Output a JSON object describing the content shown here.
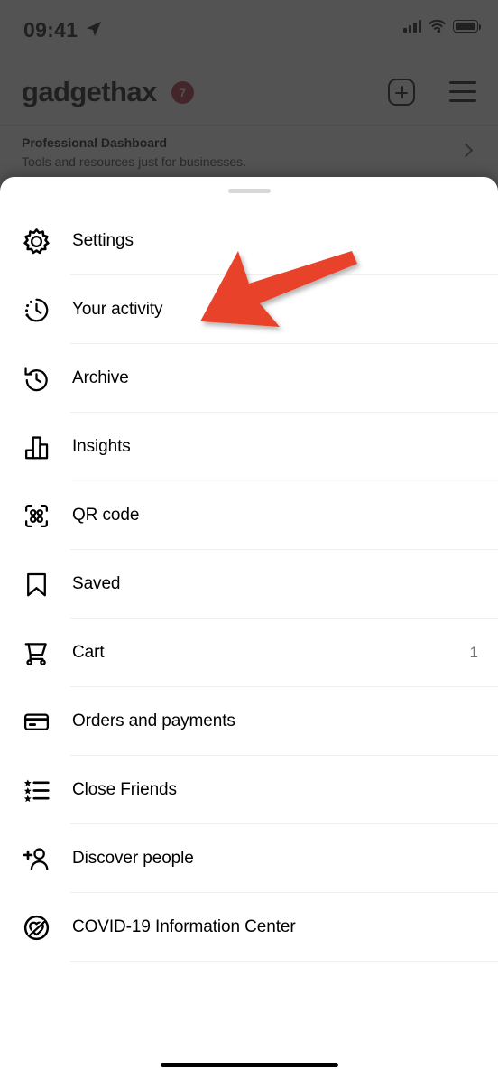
{
  "status_bar": {
    "time": "09:41",
    "location_icon": "location-arrow-icon",
    "cellular_icon": "cellular-signal-icon",
    "cellular_bars": 4,
    "wifi_icon": "wifi-icon",
    "battery_icon": "battery-full-icon"
  },
  "app_header": {
    "brand": "gadgethax",
    "notification_badge": "7",
    "badge_color": "#B02030",
    "add_icon": "plus-square-icon",
    "menu_icon": "hamburger-menu-icon"
  },
  "professional_dashboard": {
    "title": "Professional Dashboard",
    "subtitle": "Tools and resources just for businesses.",
    "chevron_icon": "chevron-right-icon"
  },
  "sheet": {
    "grabber": "drag-handle",
    "items": [
      {
        "label": "Settings",
        "icon": "gear-icon",
        "value": "",
        "divider": true
      },
      {
        "label": "Your activity",
        "icon": "clock-activity-icon",
        "value": "",
        "divider": true
      },
      {
        "label": "Archive",
        "icon": "archive-clock-icon",
        "value": "",
        "divider": true
      },
      {
        "label": "Insights",
        "icon": "bar-chart-icon",
        "value": "",
        "divider": true
      },
      {
        "label": "QR code",
        "icon": "qr-code-icon",
        "value": "",
        "divider": true
      },
      {
        "label": "Saved",
        "icon": "bookmark-icon",
        "value": "",
        "divider": true
      },
      {
        "label": "Cart",
        "icon": "shopping-cart-icon",
        "value": "1",
        "divider": true
      },
      {
        "label": "Orders and payments",
        "icon": "credit-card-icon",
        "value": "",
        "divider": true
      },
      {
        "label": "Close Friends",
        "icon": "star-list-icon",
        "value": "",
        "divider": true
      },
      {
        "label": "Discover people",
        "icon": "add-person-icon",
        "value": "",
        "divider": true
      },
      {
        "label": "COVID-19 Information Center",
        "icon": "heart-circle-icon",
        "value": "",
        "divider": true
      }
    ]
  },
  "annotation": {
    "arrow_icon": "red-pointer-arrow",
    "color": "#E8432A",
    "points_at": "Your activity"
  },
  "home_indicator": "home-indicator"
}
